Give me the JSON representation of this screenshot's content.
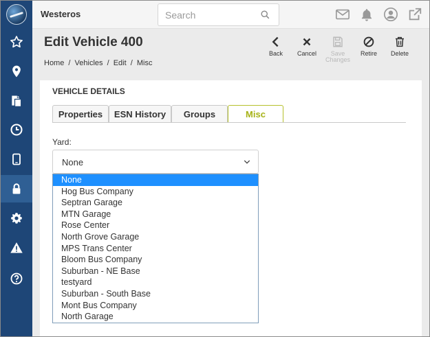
{
  "app": {
    "name": "Westeros"
  },
  "search": {
    "placeholder": "Search"
  },
  "top_icons": [
    "mail-icon",
    "bell-icon",
    "user-icon",
    "external-link-icon"
  ],
  "leftnav": {
    "items": [
      {
        "name": "favorites",
        "icon": "star-icon"
      },
      {
        "name": "locations",
        "icon": "map-pin-icon"
      },
      {
        "name": "documents",
        "icon": "documents-icon"
      },
      {
        "name": "history",
        "icon": "clock-icon"
      },
      {
        "name": "devices",
        "icon": "tablet-icon"
      },
      {
        "name": "security",
        "icon": "lock-icon",
        "active": true
      },
      {
        "name": "settings",
        "icon": "gear-icon"
      },
      {
        "name": "alerts",
        "icon": "warning-icon"
      },
      {
        "name": "help",
        "icon": "help-icon"
      }
    ]
  },
  "header": {
    "title": "Edit Vehicle 400",
    "breadcrumb": [
      "Home",
      "Vehicles",
      "Edit",
      "Misc"
    ],
    "separator": "/"
  },
  "toolbar": {
    "back": "Back",
    "cancel": "Cancel",
    "save": "Save Changes",
    "retire": "Retire",
    "delete": "Delete"
  },
  "section": {
    "title": "VEHICLE DETAILS"
  },
  "tabs": [
    {
      "label": "Properties",
      "active": false
    },
    {
      "label": "ESN History",
      "active": false
    },
    {
      "label": "Groups",
      "active": false
    },
    {
      "label": "Misc",
      "active": true
    }
  ],
  "yard": {
    "label": "Yard:",
    "value": "None",
    "options": [
      "None",
      "Hog Bus Company",
      "Septran Garage",
      "MTN Garage",
      "Rose Center",
      "North Grove Garage",
      "MPS Trans Center",
      "Bloom Bus Company",
      "Suburban - NE Base",
      "testyard",
      "Suburban - South Base",
      "Mont Bus Company",
      "North Garage"
    ],
    "highlighted_index": 0
  },
  "colors": {
    "nav_bg": "#1e4677",
    "nav_active": "#2f5f94",
    "accent": "#a6b215",
    "highlight": "#1e90ff"
  }
}
